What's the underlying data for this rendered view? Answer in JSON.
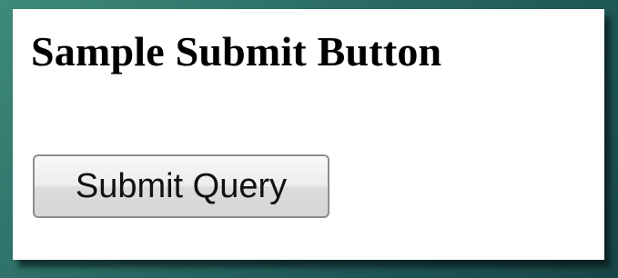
{
  "page": {
    "title": "Sample Submit Button"
  },
  "form": {
    "submit_label": "Submit Query"
  }
}
